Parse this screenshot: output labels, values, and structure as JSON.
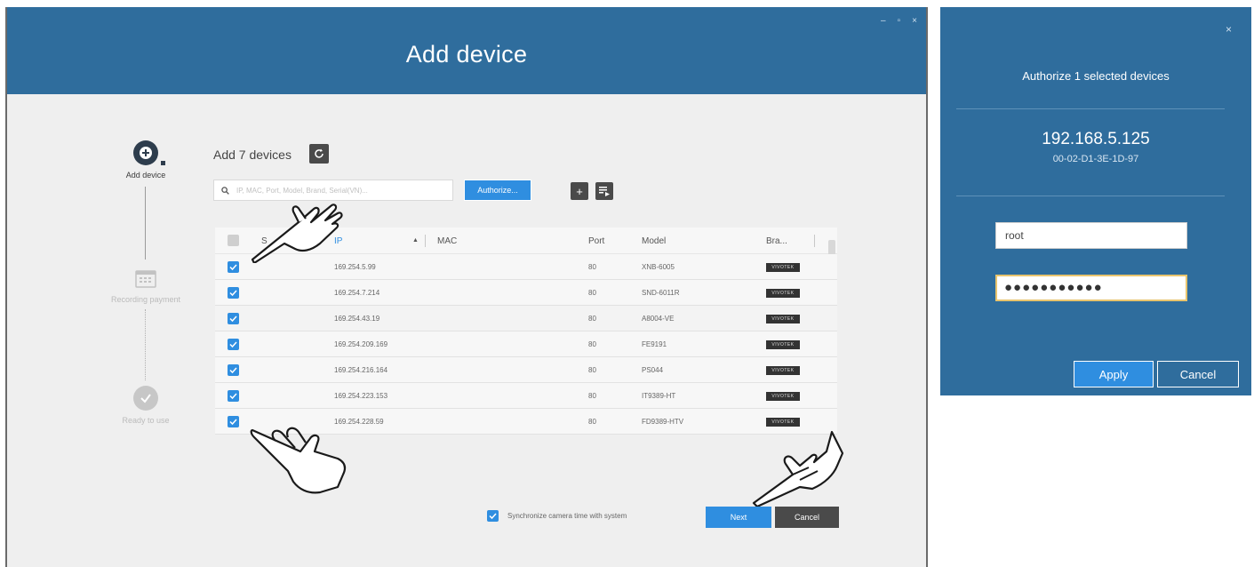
{
  "window": {
    "title": "Add device",
    "controls": [
      "–",
      "▫",
      "×"
    ]
  },
  "stepper": {
    "steps": [
      {
        "label": "Add device",
        "state": "active",
        "icon": "add-device-icon"
      },
      {
        "label": "Recording payment",
        "state": "inactive",
        "icon": "calendar-icon"
      },
      {
        "label": "Ready to use",
        "state": "inactive",
        "icon": "check-circle-icon"
      }
    ]
  },
  "content": {
    "count_label": "Add 7 devices",
    "search_placeholder": "IP, MAC, Port, Model, Brand, Serial(VN)...",
    "authorize_label": "Authorize...",
    "add_icon": "plus-icon",
    "import_icon": "import-list-icon"
  },
  "table": {
    "headers": {
      "select": "",
      "security": "S",
      "ip": "IP",
      "mac": "MAC",
      "port": "Port",
      "model": "Model",
      "brand": "Bra..."
    },
    "rows": [
      {
        "checked": true,
        "ip": "169.254.5.99",
        "mac": "",
        "port": "80",
        "model": "XNB-6005",
        "brand": "VIVOTEK"
      },
      {
        "checked": true,
        "ip": "169.254.7.214",
        "mac": "",
        "port": "80",
        "model": "SND-6011R",
        "brand": "VIVOTEK"
      },
      {
        "checked": true,
        "ip": "169.254.43.19",
        "mac": "",
        "port": "80",
        "model": "A8004-VE",
        "brand": "VIVOTEK"
      },
      {
        "checked": true,
        "ip": "169.254.209.169",
        "mac": "",
        "port": "80",
        "model": "FE9191",
        "brand": "VIVOTEK"
      },
      {
        "checked": true,
        "ip": "169.254.216.164",
        "mac": "",
        "port": "80",
        "model": "PS044",
        "brand": "VIVOTEK"
      },
      {
        "checked": true,
        "ip": "169.254.223.153",
        "mac": "",
        "port": "80",
        "model": "IT9389-HT",
        "brand": "VIVOTEK"
      },
      {
        "checked": true,
        "ip": "169.254.228.59",
        "mac": "",
        "port": "80",
        "model": "FD9389-HTV",
        "brand": "VIVOTEK"
      }
    ]
  },
  "footer": {
    "sync_label": "Synchronize camera time with system",
    "next_label": "Next",
    "cancel_label": "Cancel"
  },
  "auth_dialog": {
    "title": "Authorize 1 selected devices",
    "ip": "192.168.5.125",
    "mac": "00-02-D1-3E-1D-97",
    "username": "root",
    "password_mask": "●●●●●●●●●●●",
    "apply_label": "Apply",
    "cancel_label": "Cancel",
    "close": "×"
  },
  "colors": {
    "header_blue": "#2f6d9d",
    "accent_blue": "#2f8ee0",
    "dark_button": "#4a4a4a"
  }
}
